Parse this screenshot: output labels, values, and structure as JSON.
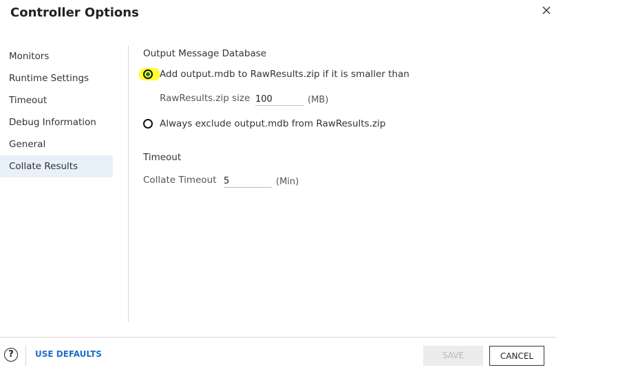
{
  "dialog": {
    "title": "Controller Options"
  },
  "sidebar": {
    "items": [
      {
        "label": "Monitors"
      },
      {
        "label": "Runtime Settings"
      },
      {
        "label": "Timeout"
      },
      {
        "label": "Debug Information"
      },
      {
        "label": "General"
      },
      {
        "label": "Collate Results",
        "active": true
      }
    ]
  },
  "output_db": {
    "title": "Output Message Database",
    "option_add": "Add output.mdb to RawResults.zip if it is smaller than",
    "size_label": "RawResults.zip size",
    "size_value": "100",
    "size_unit": "(MB)",
    "option_exclude": "Always exclude output.mdb from RawResults.zip",
    "selected": "add"
  },
  "timeout": {
    "title": "Timeout",
    "collate_label": "Collate Timeout",
    "collate_value": "5",
    "collate_unit": "(Min)"
  },
  "footer": {
    "help": "?",
    "use_defaults": "USE DEFAULTS",
    "save": "SAVE",
    "cancel": "CANCEL"
  },
  "colors": {
    "accent": "#1f6fc7",
    "radio_selected": "#1a7a2e",
    "highlight": "#ffff33",
    "active_nav": "#e8f0fa"
  },
  "icons": {
    "close": "close-icon",
    "help": "help-icon"
  }
}
